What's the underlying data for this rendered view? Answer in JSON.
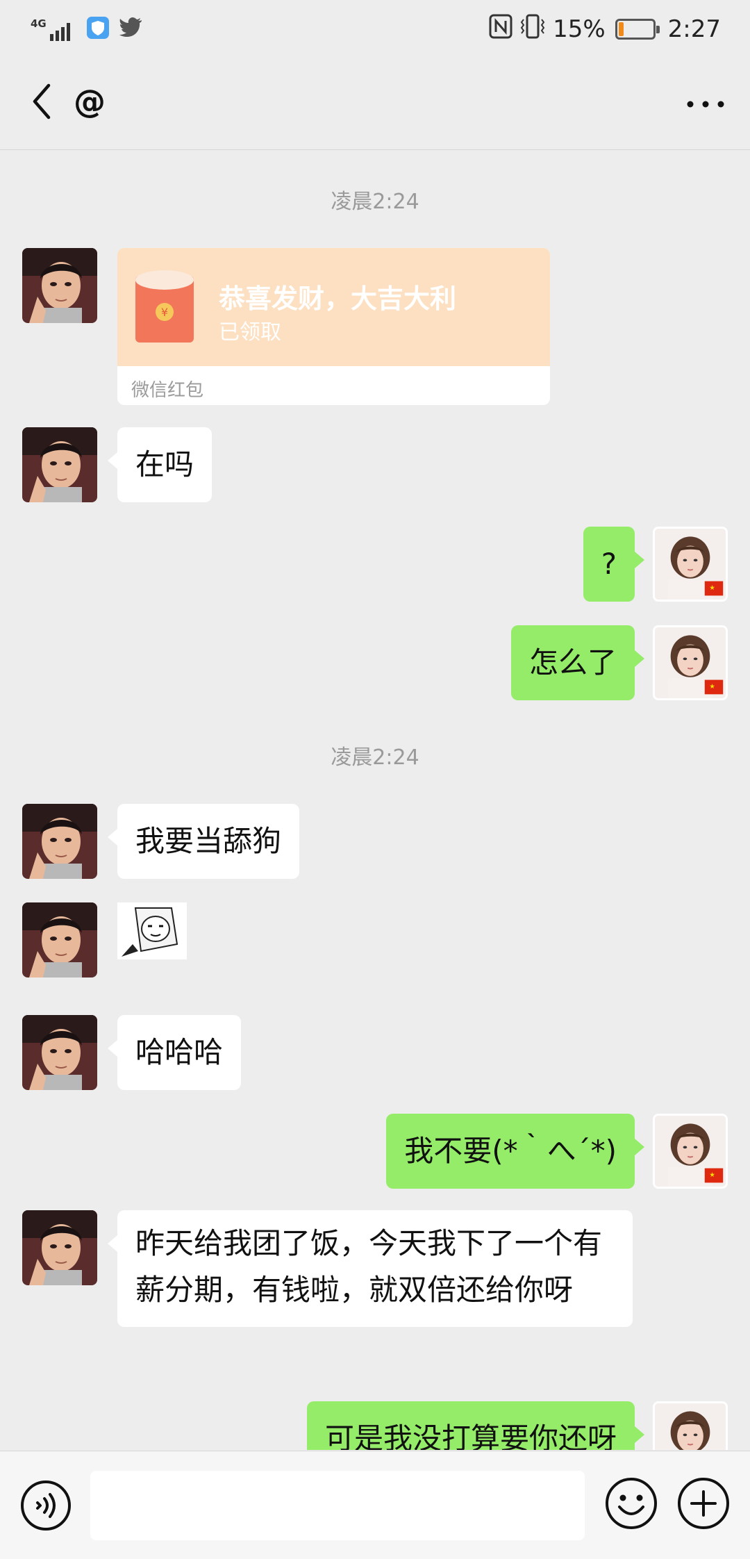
{
  "status_bar": {
    "network": "4G",
    "battery": "15%",
    "battery_level": 0.15,
    "time": "2:27"
  },
  "header": {
    "title": "@"
  },
  "chat": {
    "time_1": "凌晨2:24",
    "time_2": "凌晨2:24",
    "red_packet": {
      "title": "恭喜发财，大吉大利",
      "status": "已领取",
      "label": "微信红包",
      "symbol": "¥"
    },
    "messages": [
      {
        "side": "left",
        "text": "在吗"
      },
      {
        "side": "right",
        "text": "?"
      },
      {
        "side": "right",
        "text": "怎么了"
      },
      {
        "side": "left",
        "text": "我要当舔狗"
      },
      {
        "side": "left",
        "type": "sticker"
      },
      {
        "side": "left",
        "text": "哈哈哈"
      },
      {
        "side": "right",
        "text": "我不要(*｀へ´*)"
      },
      {
        "side": "left",
        "text": "昨天给我团了饭，今天我下了一个有薪分期，有钱啦，就双倍还给你呀"
      },
      {
        "side": "right",
        "text": "可是我没打算要你还呀"
      }
    ]
  },
  "input": {
    "value": "",
    "placeholder": ""
  },
  "colors": {
    "background": "#ededed",
    "right_bubble": "#95ec69",
    "left_bubble": "#ffffff",
    "red_packet": "#fde0c2"
  }
}
